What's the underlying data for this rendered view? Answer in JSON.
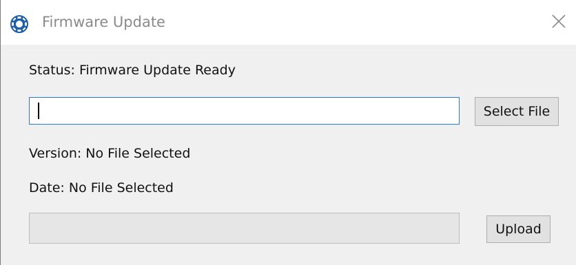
{
  "window": {
    "title": "Firmware Update",
    "icon": "app-logo-icon",
    "close_icon": "close-icon"
  },
  "status": {
    "text": "Status: Firmware Update Ready"
  },
  "file_input": {
    "value": "",
    "placeholder": ""
  },
  "buttons": {
    "select_file": "Select File",
    "upload": "Upload"
  },
  "version": {
    "text": "Version: No File Selected"
  },
  "date": {
    "text": "Date: No File Selected"
  },
  "progress": {
    "fraction": 0
  },
  "colors": {
    "accent": "#2a78d2",
    "logo": "#1e5fa8"
  }
}
